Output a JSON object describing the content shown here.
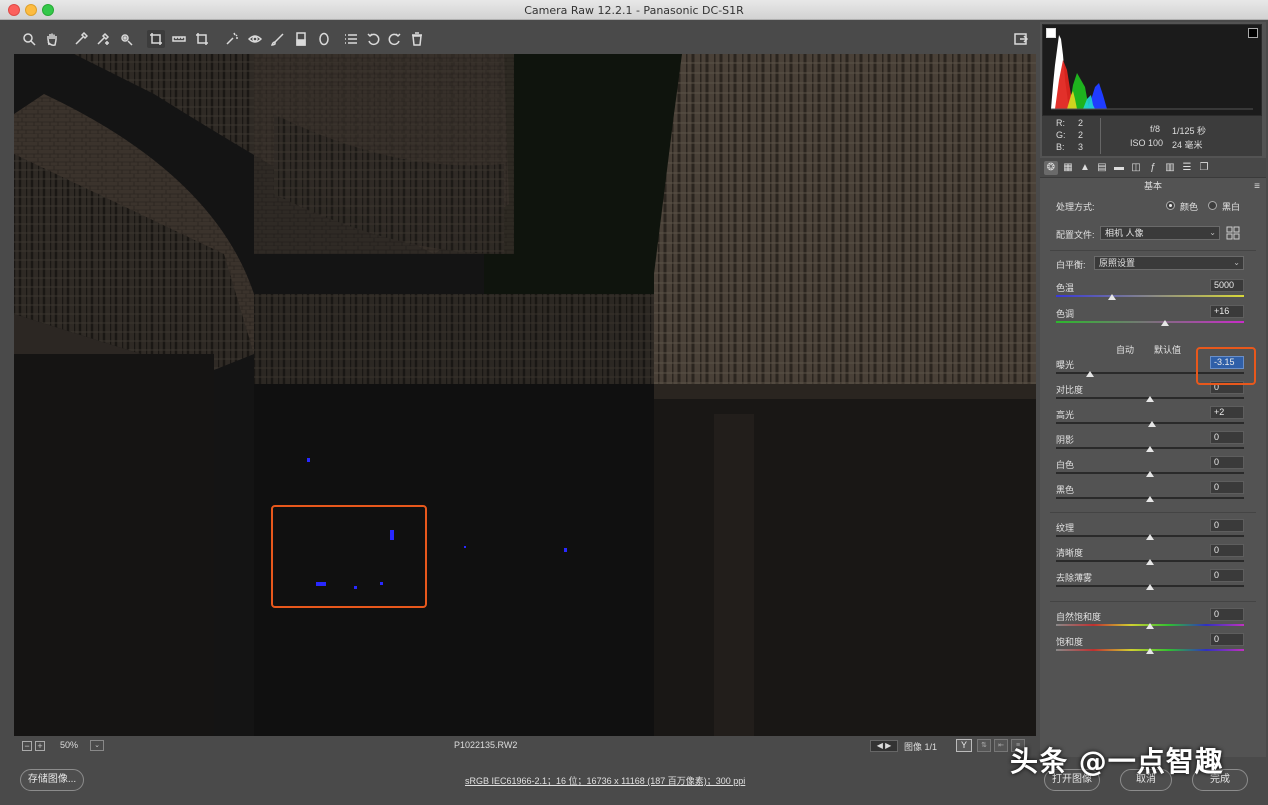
{
  "window": {
    "title": "Camera Raw 12.2.1 -  Panasonic DC-S1R"
  },
  "toolbar": {
    "tools": [
      "zoom-icon",
      "hand-icon",
      "eyedropper-icon",
      "color-sampler-icon",
      "target-adjust-icon",
      "crop-icon",
      "straighten-icon",
      "transform-icon",
      "spot-removal-icon",
      "red-eye-icon",
      "brush-icon",
      "graduated-filter-icon",
      "radial-filter-icon",
      "preferences-icon",
      "rotate-ccw-icon",
      "rotate-cw-icon",
      "trash-icon"
    ]
  },
  "status": {
    "zoom": "50%",
    "filename": "P1022135.RW2",
    "image_count": "图像 1/1",
    "y_label": "Y"
  },
  "bottom": {
    "save": "存储图像...",
    "workflow": "sRGB IEC61966-2.1；16 位；16736 x 11168 (187 百万像素)；300 ppi",
    "open": "打开图像",
    "cancel": "取消",
    "done": "完成"
  },
  "watermark": "头条 @一点智趣",
  "readout": {
    "r_label": "R:",
    "r": "2",
    "g_label": "G:",
    "g": "2",
    "b_label": "B:",
    "b": "3",
    "aperture": "f/8",
    "shutter": "1/125 秒",
    "iso": "ISO 100",
    "focal": "24 毫米"
  },
  "panel": {
    "section": "基本",
    "treatment_label": "处理方式:",
    "color": "颜色",
    "bw": "黑白",
    "profile_label": "配置文件:",
    "profile": "相机 人像",
    "wb_label": "白平衡:",
    "wb": "原照设置",
    "auto": "自动",
    "default": "默认值"
  },
  "sliders": [
    {
      "label": "色温",
      "value": "5000",
      "pos": 0.3
    },
    {
      "label": "色调",
      "value": "+16",
      "pos": 0.58
    },
    {
      "label": "曝光",
      "value": "-3.15",
      "pos": 0.18
    },
    {
      "label": "对比度",
      "value": "0",
      "pos": 0.5
    },
    {
      "label": "高光",
      "value": "+2",
      "pos": 0.51
    },
    {
      "label": "阴影",
      "value": "0",
      "pos": 0.5
    },
    {
      "label": "白色",
      "value": "0",
      "pos": 0.5
    },
    {
      "label": "黑色",
      "value": "0",
      "pos": 0.5
    },
    {
      "label": "纹理",
      "value": "0",
      "pos": 0.5
    },
    {
      "label": "清晰度",
      "value": "0",
      "pos": 0.5
    },
    {
      "label": "去除薄雾",
      "value": "0",
      "pos": 0.5
    },
    {
      "label": "自然饱和度",
      "value": "0",
      "pos": 0.5
    },
    {
      "label": "饱和度",
      "value": "0",
      "pos": 0.5
    }
  ],
  "colors": {
    "highlight": "#e8581c",
    "selection": "#2f5fa8"
  }
}
